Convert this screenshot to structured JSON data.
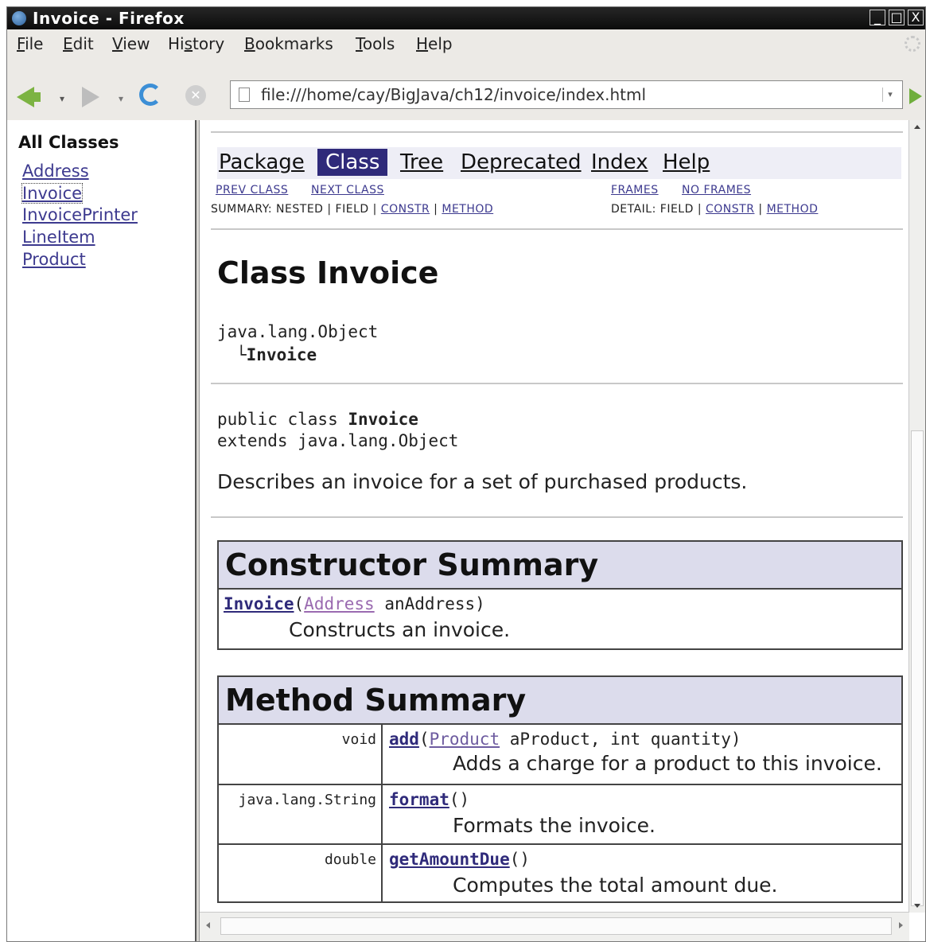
{
  "window": {
    "title": "Invoice - Firefox",
    "controls": {
      "minimize": "_",
      "maximize": "□",
      "close": "X"
    }
  },
  "menu": [
    "File",
    "Edit",
    "View",
    "History",
    "Bookmarks",
    "Tools",
    "Help"
  ],
  "menu_accel": [
    "F",
    "E",
    "V",
    "s",
    "B",
    "T",
    "H"
  ],
  "toolbar": {
    "url": "file:///home/cay/BigJava/ch12/invoice/index.html"
  },
  "sidebar": {
    "heading": "All Classes",
    "classes": [
      "Address",
      "Invoice",
      "InvoicePrinter",
      "LineItem",
      "Product"
    ]
  },
  "doc": {
    "nav": {
      "package": "Package",
      "class": "Class",
      "tree": "Tree",
      "deprecated": "Deprecated",
      "index": "Index",
      "help": "Help"
    },
    "subnav": {
      "prev_class": "PREV CLASS",
      "next_class": "NEXT CLASS",
      "frames": "FRAMES",
      "no_frames": "NO FRAMES",
      "summary_prefix": "SUMMARY: NESTED | FIELD | ",
      "summary_constr": "CONSTR",
      "summary_method": "METHOD",
      "detail_prefix": "DETAIL: FIELD | ",
      "detail_constr": "CONSTR",
      "detail_method": "METHOD",
      "sep": " | "
    },
    "class_title": "Class Invoice",
    "hierarchy": {
      "parent": "java.lang.Object",
      "branch": "└",
      "child": "Invoice"
    },
    "declaration": {
      "prefix": "public class ",
      "name": "Invoice",
      "extends": "extends java.lang.Object"
    },
    "description": "Describes an invoice for a set of purchased products.",
    "constructor_summary": {
      "heading": "Constructor Summary",
      "rows": [
        {
          "name": "Invoice",
          "open": "(",
          "param_type": "Address",
          "params_rest": " anAddress)",
          "desc": "Constructs an invoice."
        }
      ]
    },
    "method_summary": {
      "heading": "Method Summary",
      "rows": [
        {
          "return_type": "void",
          "name": "add",
          "open": "(",
          "param_type": "Product",
          "params_rest": " aProduct, int quantity)",
          "desc": "Adds a charge for a product to this invoice."
        },
        {
          "return_type": "java.lang.String",
          "name": "format",
          "open": "",
          "param_type": "",
          "params_rest": "()",
          "desc": "Formats the invoice."
        },
        {
          "return_type": "double",
          "name": "getAmountDue",
          "open": "",
          "param_type": "",
          "params_rest": "()",
          "desc": "Computes the total amount due."
        }
      ]
    }
  }
}
